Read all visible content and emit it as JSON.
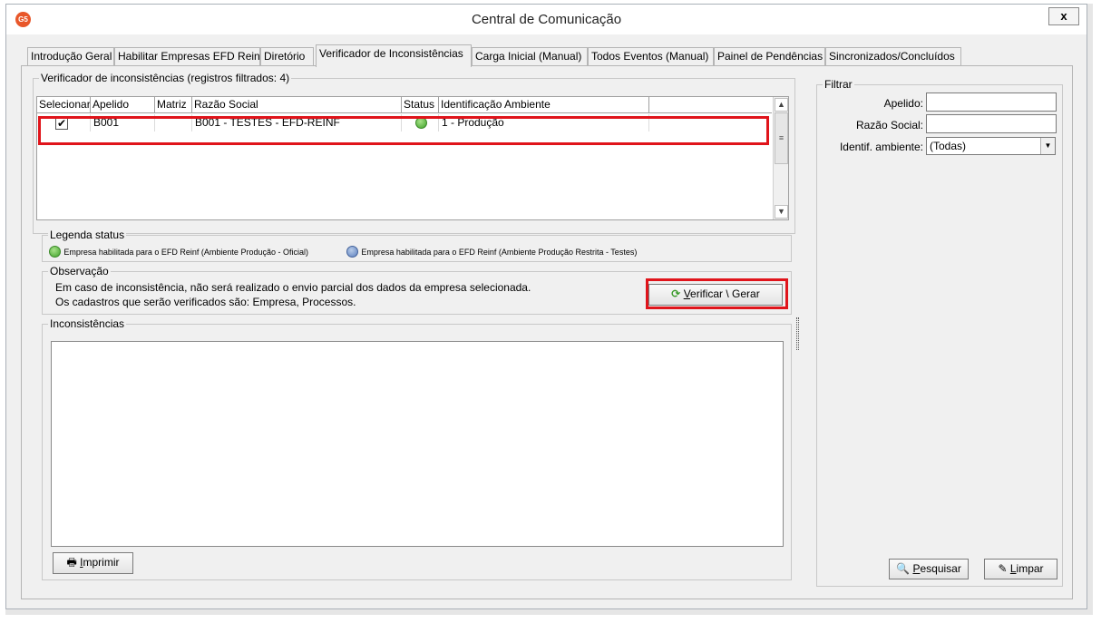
{
  "window": {
    "title": "Central de Comunicação",
    "app_icon_text": "G5",
    "close_label": "x"
  },
  "tabs": [
    {
      "label": "Introdução Geral"
    },
    {
      "label": "Habilitar Empresas EFD Reinf"
    },
    {
      "label": "Diretório"
    },
    {
      "label": "Verificador de Inconsistências"
    },
    {
      "label": "Carga Inicial (Manual)"
    },
    {
      "label": "Todos Eventos (Manual)"
    },
    {
      "label": "Painel de Pendências"
    },
    {
      "label": "Sincronizados/Concluídos"
    }
  ],
  "active_tab": "Verificador de Inconsistências",
  "verificador": {
    "group_title": "Verificador de inconsistências (registros filtrados: 4)",
    "columns": [
      "Selecionar",
      "Apelido",
      "Matriz",
      "Razão Social",
      "Status",
      "Identificação Ambiente"
    ],
    "rows": [
      {
        "selected": true,
        "check_glyph": "✔",
        "apelido": "B001",
        "matriz": "",
        "razao_social": "B001 - TESTES - EFD-REINF",
        "status": "green",
        "ambiente": "1 - Produção"
      }
    ]
  },
  "legenda": {
    "title": "Legenda status",
    "green_text": "Empresa habilitada para o EFD Reinf (Ambiente Produção - Oficial)",
    "blue_text": "Empresa habilitada para o EFD Reinf (Ambiente Produção Restrita - Testes)"
  },
  "observacao": {
    "title": "Observação",
    "line1": "Em caso de inconsistência, não será realizado o envio parcial dos dados da empresa selecionada.",
    "line2": "Os cadastros que serão verificados são: Empresa, Processos.",
    "verify_button_u": "V",
    "verify_button_rest": "erificar \\ Gerar"
  },
  "inconsistencias": {
    "title": "Inconsistências",
    "print_button_u": "I",
    "print_button_rest": "mprimir"
  },
  "filtrar": {
    "title": "Filtrar",
    "apelido_label": "Apelido:",
    "razao_label": "Razão Social:",
    "ambiente_label": "Identif. ambiente:",
    "ambiente_value": "(Todas)",
    "search_button_u": "P",
    "search_button_rest": "esquisar",
    "clear_button_u": "L",
    "clear_button_rest": "impar"
  },
  "colors": {
    "highlight_red": "#e0141b",
    "status_green": "#3ea228",
    "status_blue": "#5b7fbf"
  }
}
